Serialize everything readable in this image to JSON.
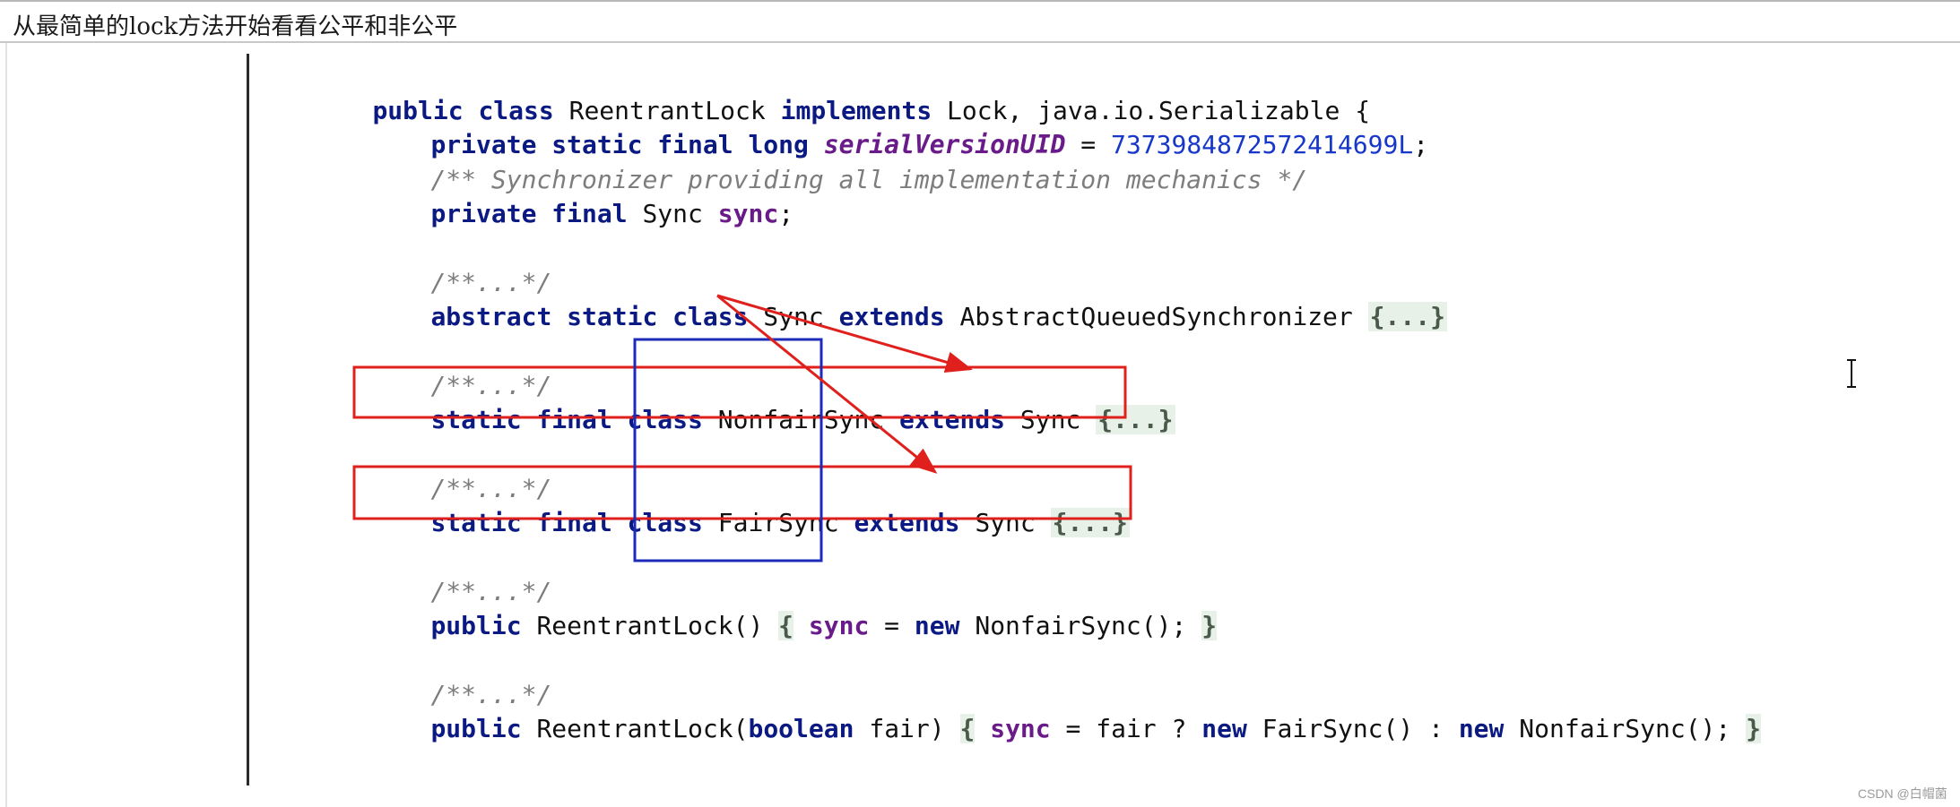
{
  "window": {
    "title": "从最简单的lock方法开始看看公平和非公平"
  },
  "colors": {
    "keyword": "#0b1a82",
    "field": "#6a1b8a",
    "number": "#1737c9",
    "comment": "#7d7d7d",
    "fold_background": "#e7f1e7",
    "highlight_box_red": "#e0201c",
    "highlight_box_blue": "#1c2bb8",
    "arrow": "#e0201c"
  },
  "code": {
    "l1": {
      "kw1": "public class",
      "t1": " ReentrantLock ",
      "kw2": "implements",
      "t2": " Lock, java.io.Serializable {"
    },
    "l2": {
      "kw1": "private static final long",
      "sp": " ",
      "fld": "serialVersionUID",
      "eq": " = ",
      "num": "7373984872572414699L",
      "semi": ";"
    },
    "l3": {
      "cmt": "/** Synchronizer providing all implementation mechanics */"
    },
    "l4": {
      "kw1": "private final",
      "t1": " Sync ",
      "fld": "sync",
      "semi": ";"
    },
    "l5": {
      "cmt": "/**...*/"
    },
    "l6": {
      "kw1": "abstract static class",
      "t1": " Sync ",
      "kw2": "extends",
      "t2": " AbstractQueuedSynchronizer ",
      "fold": "{...}"
    },
    "l7": {
      "cmt": "/**...*/"
    },
    "l8": {
      "kw1": "static final class",
      "t1": " NonfairSync ",
      "kw2": "extends",
      "t2": " Sync ",
      "fold": "{...}"
    },
    "l9": {
      "cmt": "/**...*/"
    },
    "l10": {
      "kw1": "static final class",
      "t1": " FairSync ",
      "kw2": "extends",
      "t2": " Sync ",
      "fold": "{...}"
    },
    "l11": {
      "cmt": "/**...*/"
    },
    "l12": {
      "kw1": "public",
      "t1": " ReentrantLock() ",
      "ob": "{",
      "sp": " ",
      "fld": "sync",
      "eq": " = ",
      "kw2": "new",
      "t2": " NonfairSync(); ",
      "cb": "}"
    },
    "l13": {
      "cmt": "/**...*/"
    },
    "l14": {
      "kw1": "public",
      "t1": " ReentrantLock(",
      "kw2": "boolean",
      "t2": " fair) ",
      "ob": "{",
      "sp": " ",
      "fld": "sync",
      "t3": " = fair ? ",
      "kw3": "new",
      "t4": " FairSync() : ",
      "kw4": "new",
      "t5": " NonfairSync(); ",
      "cb": "}"
    }
  },
  "icons": {
    "text_cursor": "i-beam-cursor-icon"
  },
  "watermark": "CSDN @白帽菌"
}
